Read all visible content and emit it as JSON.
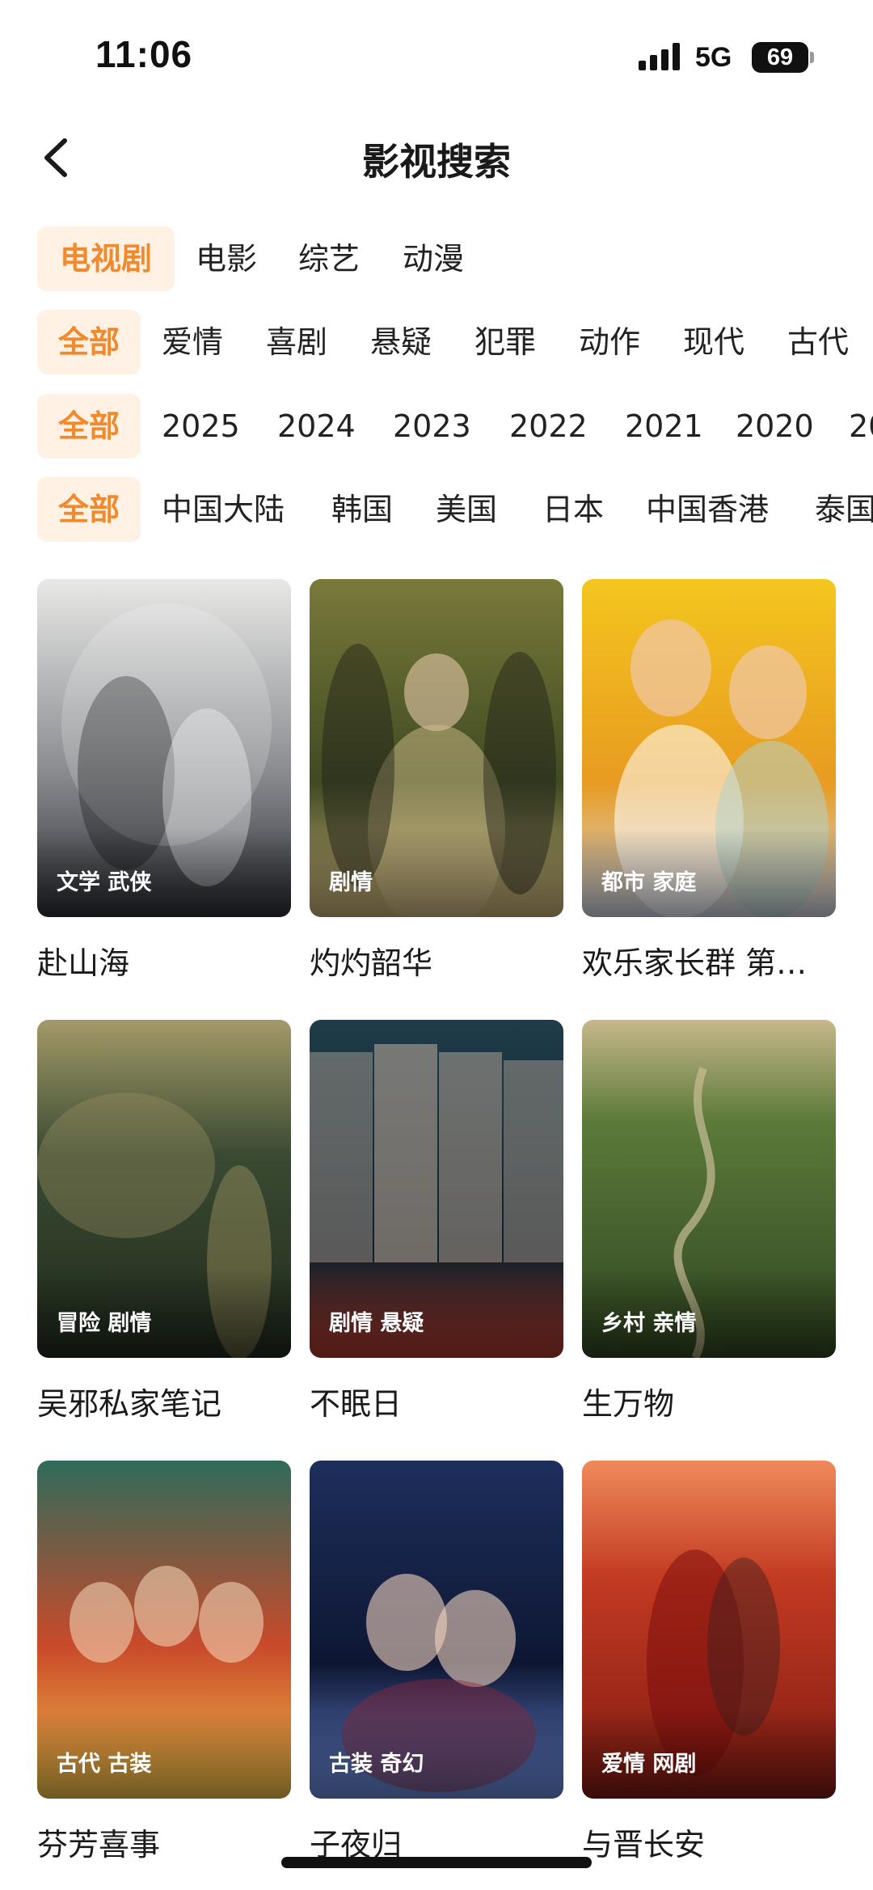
{
  "status_bar": {
    "time": "11:06",
    "network": "5G",
    "battery": "69"
  },
  "nav": {
    "title": "影视搜索",
    "back_icon": "chevron-left-icon"
  },
  "filters": {
    "type": [
      "电视剧",
      "电影",
      "综艺",
      "动漫"
    ],
    "genre": [
      "全部",
      "爱情",
      "喜剧",
      "悬疑",
      "犯罪",
      "动作",
      "现代",
      "古代"
    ],
    "year": [
      "全部",
      "2025",
      "2024",
      "2023",
      "2022",
      "2021",
      "2020",
      "20"
    ],
    "region": [
      "全部",
      "中国大陆",
      "韩国",
      "美国",
      "日本",
      "中国香港",
      "泰国"
    ]
  },
  "items": [
    {
      "title": "赴山海",
      "tags": "文学 武侠",
      "palette": [
        "#e8e8e6",
        "#8d8f93",
        "#2d3036"
      ]
    },
    {
      "title": "灼灼韶华",
      "tags": "剧情",
      "palette": [
        "#7a7a3a",
        "#3f4a22",
        "#c9b27a"
      ]
    },
    {
      "title": "欢乐家长群 第…",
      "tags": "都市 家庭",
      "palette": [
        "#f4c61f",
        "#e89b20",
        "#cfd8e8"
      ]
    },
    {
      "title": "吴邪私家笔记",
      "tags": "冒险 剧情",
      "palette": [
        "#3a4a32",
        "#1f2a1c",
        "#a39a68"
      ]
    },
    {
      "title": "不眠日",
      "tags": "剧情 悬疑",
      "palette": [
        "#1f3c48",
        "#0f1f28",
        "#b03a2e"
      ]
    },
    {
      "title": "生万物",
      "tags": "乡村 亲情",
      "palette": [
        "#5c7a3a",
        "#2f4520",
        "#c7b88a"
      ]
    },
    {
      "title": "芬芳喜事",
      "tags": "古代 古装",
      "palette": [
        "#2f6b5a",
        "#c94a2a",
        "#f1c24a"
      ]
    },
    {
      "title": "子夜归",
      "tags": "古装 奇幻",
      "palette": [
        "#1e2f5c",
        "#0e1633",
        "#6a8ad8"
      ]
    },
    {
      "title": "与晋长安",
      "tags": "爱情 网剧",
      "palette": [
        "#c23a22",
        "#7e1a12",
        "#f08a5a"
      ]
    }
  ],
  "colors": {
    "accent": "#f08a2d",
    "active_chip_bg": "#fff1e4"
  }
}
